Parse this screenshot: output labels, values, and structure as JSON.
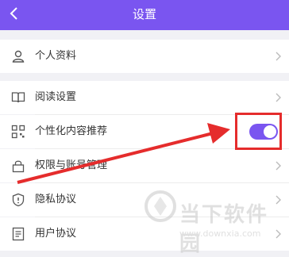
{
  "header": {
    "title": "设置",
    "back_icon": "chevron-left-icon",
    "background": "#7a55f0"
  },
  "profile": {
    "label": "个人资料",
    "icon": "user-icon"
  },
  "settings": {
    "items": [
      {
        "label": "阅读设置",
        "icon": "book-icon",
        "type": "chevron"
      },
      {
        "label": "个性化内容推荐",
        "icon": "grid-icon",
        "type": "toggle",
        "toggle_on": true
      },
      {
        "label": "权限与账号管理",
        "icon": "lock-icon",
        "type": "chevron"
      },
      {
        "label": "隐私协议",
        "icon": "shield-icon",
        "type": "chevron"
      },
      {
        "label": "用户协议",
        "icon": "document-icon",
        "type": "chevron"
      }
    ]
  },
  "annotation": {
    "color": "#e52c2c"
  },
  "watermark": {
    "name": "当下软件园",
    "url": "www.downxia.com"
  }
}
